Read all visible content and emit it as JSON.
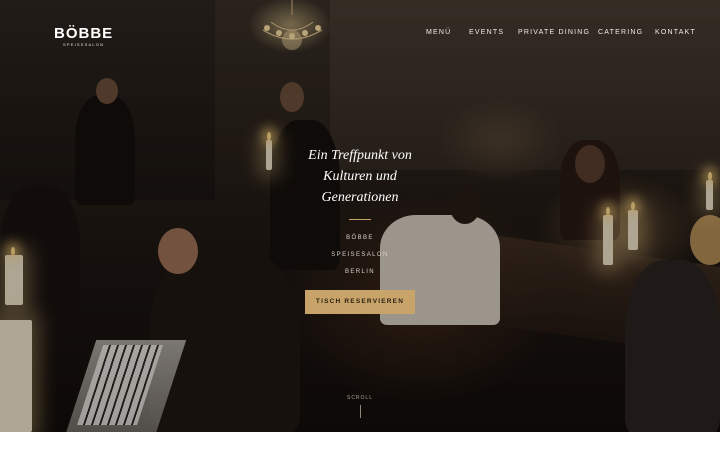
{
  "brand": {
    "name": "BÖBBE",
    "subtitle": "SPEISESALON"
  },
  "nav": {
    "items": [
      "MENÜ",
      "EVENTS",
      "PRIVATE DINING",
      "CATERING",
      "KONTAKT"
    ]
  },
  "hero": {
    "tagline": "Ein Treffpunkt von Kulturen und Generationen",
    "meta": [
      "BÖBBE",
      "SPEISESALON",
      "BERLIN"
    ],
    "cta_label": "TISCH RESERVIEREN",
    "scroll_label": "SCROLL"
  },
  "colors": {
    "accent": "#c9a46a",
    "text": "#ffffff",
    "background": "#1c1511"
  },
  "icons": {
    "scroll": "scroll-line-icon"
  }
}
